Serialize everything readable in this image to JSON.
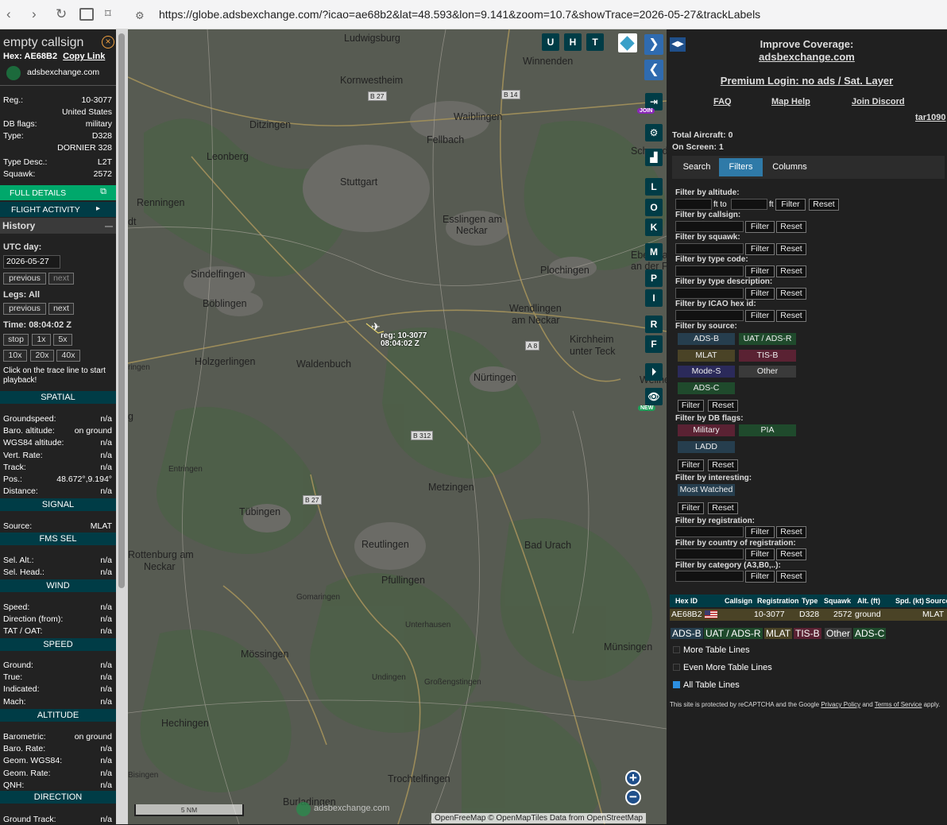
{
  "browser": {
    "url": "https://globe.adsbexchange.com/?icao=ae68b2&lat=48.593&lon=9.141&zoom=10.7&showTrace=2026-05-27&trackLabels"
  },
  "aircraft": {
    "callsign": "empty callsign",
    "hex_label": "Hex:",
    "hex": "AE68B2",
    "copy_link": "Copy Link",
    "source_site": "adsbexchange.com",
    "fields": [
      {
        "k": "Reg.:",
        "v": "10-3077"
      },
      {
        "k": "",
        "v": "United States"
      },
      {
        "k": "DB flags:",
        "v": "military"
      },
      {
        "k": "Type:",
        "v": "D328"
      },
      {
        "k": "",
        "v": "DORNIER 328"
      },
      {
        "k": "Type Desc.:",
        "v": "L2T"
      },
      {
        "k": "Squawk:",
        "v": "2572"
      }
    ],
    "full_details": "FULL DETAILS",
    "flight_activity": "FLIGHT ACTIVITY"
  },
  "history": {
    "title": "History",
    "utc_label": "UTC day:",
    "utc_day": "2026-05-27",
    "previous": "previous",
    "next": "next",
    "legs": "Legs: All",
    "time": "Time: 08:04:02 Z",
    "stop": "stop",
    "x1": "1x",
    "x5": "5x",
    "x10": "10x",
    "x20": "20x",
    "x40": "40x",
    "hint": "Click on the trace line to start playback!"
  },
  "spatial": {
    "title": "SPATIAL",
    "rows": [
      {
        "k": "Groundspeed:",
        "v": "n/a"
      },
      {
        "k": "Baro. altitude:",
        "v": "on ground"
      },
      {
        "k": "WGS84 altitude:",
        "v": "n/a"
      },
      {
        "k": "Vert. Rate:",
        "v": "n/a"
      },
      {
        "k": "Track:",
        "v": "n/a"
      },
      {
        "k": "Pos.:",
        "v": "48.672°,9.194°"
      },
      {
        "k": "Distance:",
        "v": "n/a"
      }
    ]
  },
  "signal": {
    "title": "SIGNAL",
    "rows": [
      {
        "k": "Source:",
        "v": "MLAT"
      }
    ]
  },
  "fms": {
    "title": "FMS SEL",
    "rows": [
      {
        "k": "Sel. Alt.:",
        "v": "n/a"
      },
      {
        "k": "Sel. Head.:",
        "v": "n/a"
      }
    ]
  },
  "wind": {
    "title": "WIND",
    "rows": [
      {
        "k": "Speed:",
        "v": "n/a"
      },
      {
        "k": "Direction (from):",
        "v": "n/a"
      },
      {
        "k": "TAT / OAT:",
        "v": "n/a"
      }
    ]
  },
  "speed": {
    "title": "SPEED",
    "rows": [
      {
        "k": "Ground:",
        "v": "n/a"
      },
      {
        "k": "True:",
        "v": "n/a"
      },
      {
        "k": "Indicated:",
        "v": "n/a"
      },
      {
        "k": "Mach:",
        "v": "n/a"
      }
    ]
  },
  "altitude": {
    "title": "ALTITUDE",
    "rows": [
      {
        "k": "Barometric:",
        "v": "on ground"
      },
      {
        "k": "Baro. Rate:",
        "v": "n/a"
      },
      {
        "k": "Geom. WGS84:",
        "v": "n/a"
      },
      {
        "k": "Geom. Rate:",
        "v": "n/a"
      },
      {
        "k": "QNH:",
        "v": "n/a"
      }
    ]
  },
  "direction": {
    "title": "DIRECTION",
    "rows": [
      {
        "k": "Ground Track:",
        "v": "n/a"
      }
    ]
  },
  "map": {
    "places": [
      "Ludwigsburg",
      "Winnenden",
      "Kornwestheim",
      "Waiblingen",
      "Ditzingen",
      "Fellbach",
      "Leonberg",
      "Stuttgart",
      "Renningen",
      "Esslingen am",
      "Neckar",
      "Sindelfingen",
      "Plochingen",
      "Böblingen",
      "Wendlingen",
      "am Neckar",
      "Kirchheim",
      "unter Teck",
      "Holzgerlingen",
      "Waldenbuch",
      "Nürtingen",
      "Entringen",
      "Metzingen",
      "Tübingen",
      "Reutlingen",
      "Bad Urach",
      "Rottenburg am",
      "Neckar",
      "Pfullingen",
      "Gomaringen",
      "Unterhausen",
      "Münsingen",
      "Mössingen",
      "Undingen",
      "Großengstingen",
      "Hechingen",
      "Bisingen",
      "Trochtelfingen",
      "Burladingen",
      "Schorndorf",
      "Ebersbach",
      "an der Fils",
      "Weilheim",
      "dt",
      "ringen",
      "g"
    ],
    "routes": [
      "B 27",
      "B 14",
      "A 8",
      "B 312",
      "B 27"
    ],
    "plane_label_reg": "reg: 10-3077",
    "plane_label_time": "08:04:02 Z",
    "buttons": {
      "u": "U",
      "h": "H",
      "t": "T",
      "l": "L",
      "o": "O",
      "k": "K",
      "m": "M",
      "p": "P",
      "i": "I",
      "r": "R",
      "f": "F"
    },
    "join_badge": "JOIN",
    "new_badge": "NEW",
    "scale": "5 NM",
    "watermark": "adsbexchange.com",
    "attribution": "OpenFreeMap © OpenMapTiles Data from OpenStreetMap",
    "zoom_in": "+",
    "zoom_out": "−"
  },
  "right": {
    "improve": "Improve Coverage:",
    "site": "adsbexchange.com",
    "premium": "Premium Login: no ads / Sat. Layer",
    "faq": "FAQ",
    "help": "Map Help",
    "discord": "Join Discord",
    "user": "tar1090",
    "total": "Total Aircraft: 0",
    "onscreen": "On Screen: 1",
    "tabs": [
      "Search",
      "Filters",
      "Columns"
    ],
    "filters": {
      "alt": "Filter by altitude:",
      "ftto": "ft to",
      "ft": "ft",
      "filter": "Filter",
      "reset": "Reset",
      "callsign": "Filter by callsign:",
      "squawk": "Filter by squawk:",
      "typecode": "Filter by type code:",
      "typedesc": "Filter by type description:",
      "icao": "Filter by ICAO hex id:",
      "source": "Filter by source:",
      "sources": [
        "ADS-B",
        "UAT / ADS-R",
        "MLAT",
        "TIS-B",
        "Mode-S",
        "Other",
        "ADS-C"
      ],
      "dbflags": "Filter by DB flags:",
      "flags": [
        "Military",
        "PIA",
        "LADD"
      ],
      "interesting": "Filter by interesting:",
      "watched": "Most Watched",
      "registration": "Filter by registration:",
      "country": "Filter by country of registration:",
      "category": "Filter by category (A3,B0,..):"
    },
    "table": {
      "headers": [
        "Hex ID",
        "Callsign",
        "Registration",
        "Type",
        "Squawk",
        "Alt. (ft)",
        "Spd. (kt)",
        "Source"
      ],
      "row": {
        "hex": "AE68B2",
        "callsign": "",
        "reg": "10-3077",
        "type": "D328",
        "squawk": "2572",
        "alt": "ground",
        "spd": "",
        "src": "MLAT"
      }
    },
    "legend": [
      "ADS-B",
      "UAT / ADS-R",
      "MLAT",
      "TIS-B",
      "Other",
      "ADS-C"
    ],
    "more_lines": "More Table Lines",
    "even_more": "Even More Table Lines",
    "all_lines": "All Table Lines",
    "captcha1": "This site is protected by reCAPTCHA and the Google",
    "privacy": "Privacy Policy",
    "and": "and",
    "terms": "Terms of Service",
    "apply": "apply."
  },
  "colors": {
    "accent": "#00a86b",
    "panel_teal": "#003c46",
    "mlat": "#4a4326",
    "adsb": "#263e4e",
    "tisb": "#5a2233",
    "military": "#5a2233",
    "pia": "#1f4a2c"
  }
}
